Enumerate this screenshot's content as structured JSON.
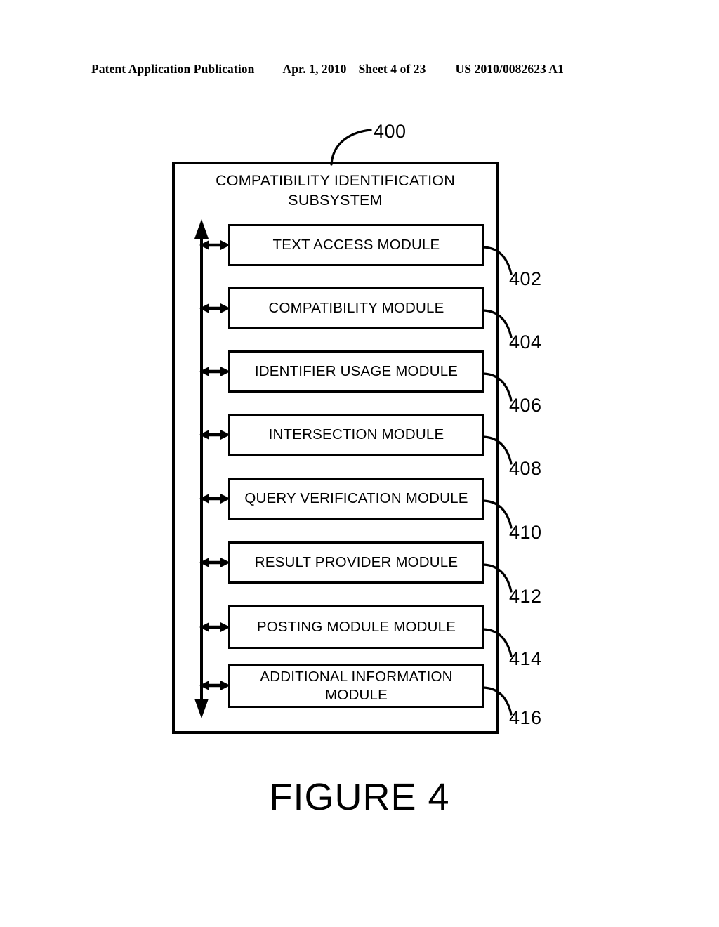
{
  "page_header": {
    "publication": "Patent Application Publication",
    "date": "Apr. 1, 2010",
    "sheet": "Sheet 4 of 23",
    "document_number": "US 2010/0082623 A1"
  },
  "figure": {
    "caption": "FIGURE 4",
    "subsystem": {
      "title": "COMPATIBILITY IDENTIFICATION\nSUBSYSTEM",
      "reference_number": "400"
    },
    "modules": [
      {
        "label": "TEXT ACCESS MODULE",
        "reference_number": "402"
      },
      {
        "label": "COMPATIBILITY MODULE",
        "reference_number": "404"
      },
      {
        "label": "IDENTIFIER USAGE MODULE",
        "reference_number": "406"
      },
      {
        "label": "INTERSECTION MODULE",
        "reference_number": "408"
      },
      {
        "label": "QUERY VERIFICATION MODULE",
        "reference_number": "410"
      },
      {
        "label": "RESULT PROVIDER MODULE",
        "reference_number": "412"
      },
      {
        "label": "POSTING MODULE MODULE",
        "reference_number": "414"
      },
      {
        "label": "ADDITIONAL INFORMATION\nMODULE",
        "reference_number": "416"
      }
    ]
  },
  "colors": {
    "ink": "#000000",
    "paper": "#ffffff"
  }
}
